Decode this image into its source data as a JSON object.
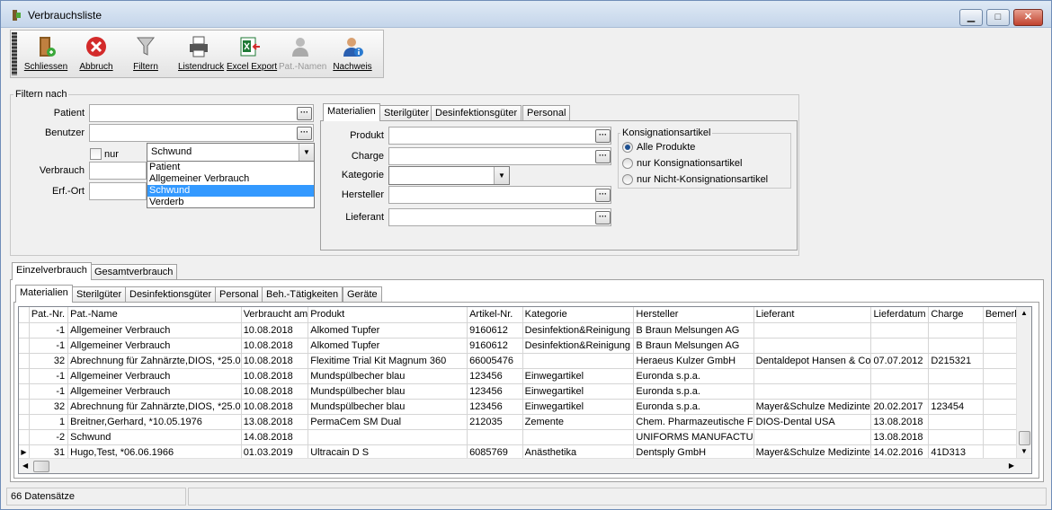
{
  "window": {
    "title": "Verbrauchsliste",
    "minimize_label": "▁",
    "maximize_label": "□",
    "close_label": "✕"
  },
  "toolbar": {
    "close": "Schliessen",
    "cancel": "Abbruch",
    "filter": "Filtern",
    "print_list": "Listendruck",
    "excel_export": "Excel Export",
    "patient_names": "Pat.-Namen",
    "proof": "Nachweis"
  },
  "filter": {
    "group_title": "Filtern nach",
    "patient_label": "Patient",
    "user_label": "Benutzer",
    "only_label": "nur",
    "consumption_label": "Verbrauch",
    "location_label": "Erf.-Ort",
    "ellipsis": "···",
    "combo_value": "Schwund",
    "combo_options": [
      "Patient",
      "Allgemeiner Verbrauch",
      "Schwund",
      "Verderb"
    ]
  },
  "material_filter": {
    "tabs": [
      "Materialien",
      "Sterilgüter",
      "Desinfektionsgüter",
      "Personal"
    ],
    "product_label": "Produkt",
    "batch_label": "Charge",
    "category_label": "Kategorie",
    "manufacturer_label": "Hersteller",
    "supplier_label": "Lieferant",
    "consignment_title": "Konsignationsartikel",
    "consignment_options": [
      "Alle Produkte",
      "nur Konsignationsartikel",
      "nur Nicht-Konsignationsartikel"
    ]
  },
  "main_tabs": [
    "Einzelverbrauch",
    "Gesamtverbrauch"
  ],
  "sub_tabs": [
    "Materialien",
    "Sterilgüter",
    "Desinfektionsgüter",
    "Personal",
    "Beh.-Tätigkeiten",
    "Geräte"
  ],
  "table": {
    "columns": [
      "Pat.-Nr.",
      "Pat.-Name",
      "Verbraucht am",
      "Produkt",
      "Artikel-Nr.",
      "Kategorie",
      "Hersteller",
      "Lieferant",
      "Lieferdatum",
      "Charge",
      "Bemerkun"
    ],
    "rows": [
      [
        "-1",
        "Allgemeiner Verbrauch",
        "10.08.2018",
        "Alkomed Tupfer",
        "9160612",
        "Desinfektion&Reinigung",
        "B Braun Melsungen AG",
        "",
        "",
        "",
        ""
      ],
      [
        "-1",
        "Allgemeiner Verbrauch",
        "10.08.2018",
        "Alkomed Tupfer",
        "9160612",
        "Desinfektion&Reinigung",
        "B Braun Melsungen AG",
        "",
        "",
        "",
        ""
      ],
      [
        "32",
        "Abrechnung für Zahnärzte,DIOS, *25.0",
        "10.08.2018",
        "Flexitime Trial Kit Magnum 360",
        "66005476",
        "",
        "Heraeus Kulzer GmbH",
        "Dentaldepot Hansen & Co",
        "07.07.2012",
        "D215321",
        ""
      ],
      [
        "-1",
        "Allgemeiner Verbrauch",
        "10.08.2018",
        "Mundspülbecher blau",
        "123456",
        "Einwegartikel",
        "Euronda s.p.a.",
        "",
        "",
        "",
        ""
      ],
      [
        "-1",
        "Allgemeiner Verbrauch",
        "10.08.2018",
        "Mundspülbecher blau",
        "123456",
        "Einwegartikel",
        "Euronda s.p.a.",
        "",
        "",
        "",
        ""
      ],
      [
        "32",
        "Abrechnung für Zahnärzte,DIOS, *25.0",
        "10.08.2018",
        "Mundspülbecher blau",
        "123456",
        "Einwegartikel",
        "Euronda s.p.a.",
        "Mayer&Schulze Medizinte",
        "20.02.2017",
        "123454",
        ""
      ],
      [
        "1",
        "Breitner,Gerhard, *10.05.1976",
        "13.08.2018",
        "PermaCem SM Dual",
        "212035",
        "Zemente",
        "Chem. Pharmazeutische F",
        "DIOS-Dental USA",
        "13.08.2018",
        "",
        ""
      ],
      [
        "-2",
        "Schwund",
        "14.08.2018",
        "",
        "",
        "",
        "UNIFORMS MANUFACTU",
        "",
        "13.08.2018",
        "",
        ""
      ],
      [
        "31",
        "Hugo,Test, *06.06.1966",
        "01.03.2019",
        "Ultracain D S",
        "6085769",
        "Anästhetika",
        "Dentsply GmbH",
        "Mayer&Schulze Medizinte",
        "14.02.2016",
        "41D313",
        ""
      ]
    ],
    "current_row_marker": "▶"
  },
  "status": {
    "record_count": "66 Datensätze"
  }
}
